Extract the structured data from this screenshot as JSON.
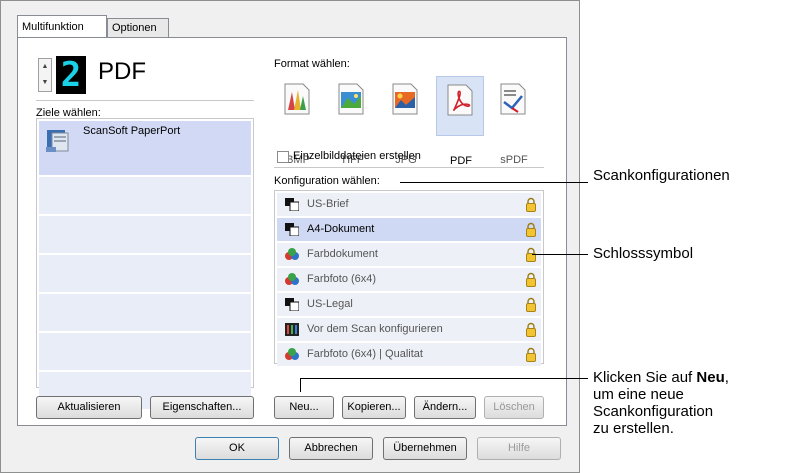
{
  "tabs": [
    {
      "label": "Multifunktion"
    },
    {
      "label": "Optionen"
    }
  ],
  "selected_format_number": "2",
  "selected_format_name": "PDF",
  "destinations_label": "Ziele wählen:",
  "destinations": [
    {
      "label": "ScanSoft PaperPort"
    }
  ],
  "format_label": "Format wählen:",
  "formats": [
    {
      "label": "BMP",
      "icon": "bmp-icon"
    },
    {
      "label": "TIFF",
      "icon": "tiff-icon"
    },
    {
      "label": "JPG",
      "icon": "jpg-icon"
    },
    {
      "label": "PDF",
      "icon": "pdf-icon",
      "selected": true
    },
    {
      "label": "sPDF",
      "icon": "spdf-icon"
    }
  ],
  "single_image_checkbox_label": "Einzelbilddateien erstellen",
  "config_label": "Konfiguration wählen:",
  "configs": [
    {
      "label": "US-Brief"
    },
    {
      "label": "A4-Dokument"
    },
    {
      "label": "Farbdokument"
    },
    {
      "label": "Farbfoto (6x4)"
    },
    {
      "label": "US-Legal"
    },
    {
      "label": "Vor dem Scan konfigurieren"
    },
    {
      "label": "Farbfoto (6x4) | Qualitat"
    }
  ],
  "buttons": {
    "refresh": "Aktualisieren",
    "properties": "Eigenschaften...",
    "new": "Neu...",
    "copy": "Kopieren...",
    "edit": "Ändern...",
    "delete": "Löschen",
    "ok": "OK",
    "cancel": "Abbrechen",
    "apply": "Übernehmen",
    "help": "Hilfe"
  },
  "annotations": {
    "scan_configs": "Scankonfigurationen",
    "lock_symbol": "Schlosssymbol",
    "new_line1_prefix": "Klicken Sie auf ",
    "new_line1_bold": "Neu",
    "new_line1_suffix": ",",
    "new_line2": "um eine neue",
    "new_line3": "Scankonfiguration",
    "new_line4": "zu erstellen."
  },
  "colors": {
    "selected_row": "#cfd9f4",
    "led_digit": "#19d2e8",
    "lock": "#e2b21c"
  }
}
